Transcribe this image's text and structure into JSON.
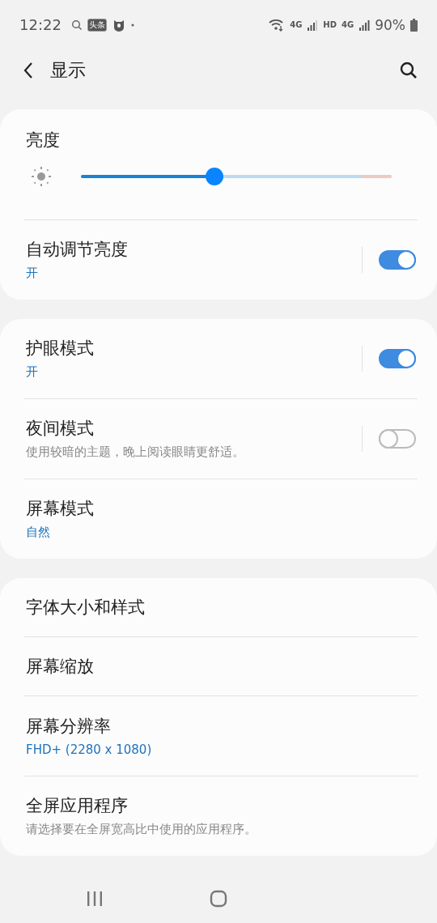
{
  "status_bar": {
    "time": "12:22",
    "app_badge": "头条",
    "network_1": "4G",
    "network_2": "HD",
    "network_3": "4G",
    "battery": "90%"
  },
  "header": {
    "title": "显示"
  },
  "cards": [
    {
      "items": [
        {
          "kind": "slider",
          "title": "亮度",
          "level": 0.43
        },
        {
          "kind": "toggle",
          "title": "自动调节亮度",
          "value": "开",
          "on": true
        }
      ]
    },
    {
      "items": [
        {
          "kind": "toggle",
          "title": "护眼模式",
          "value": "开",
          "on": true
        },
        {
          "kind": "toggle",
          "title": "夜间模式",
          "description": "使用较暗的主题，晚上阅读眼睛更舒适。",
          "on": false
        },
        {
          "kind": "plain",
          "title": "屏幕模式",
          "value": "自然"
        }
      ]
    },
    {
      "items": [
        {
          "kind": "plain",
          "title": "字体大小和样式"
        },
        {
          "kind": "plain",
          "title": "屏幕缩放"
        },
        {
          "kind": "plain",
          "title": "屏幕分辨率",
          "value": "FHD+ (2280 x 1080)"
        },
        {
          "kind": "plain",
          "title": "全屏应用程序",
          "description": "请选择要在全屏宽高比中使用的应用程序。"
        }
      ]
    }
  ]
}
